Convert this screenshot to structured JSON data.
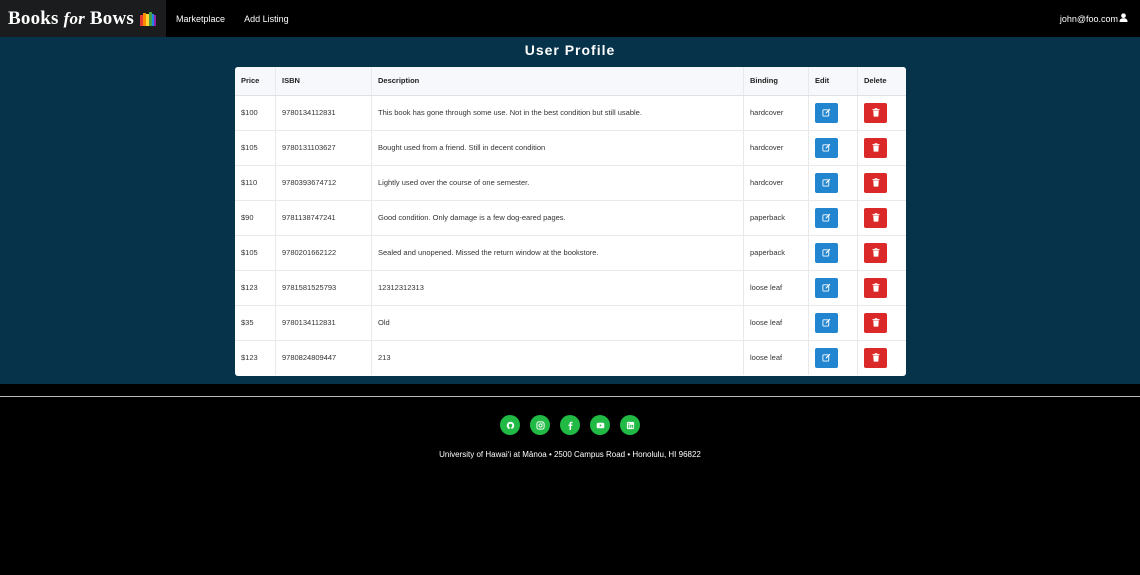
{
  "navbar": {
    "brand": {
      "part1": "Books ",
      "part2": "for",
      "part3": " Bows"
    },
    "items": [
      {
        "label": "Marketplace"
      },
      {
        "label": "Add Listing"
      }
    ],
    "user": "john@foo.com"
  },
  "page": {
    "title": "User Profile"
  },
  "table": {
    "headers": {
      "price": "Price",
      "isbn": "ISBN",
      "description": "Description",
      "binding": "Binding",
      "edit": "Edit",
      "delete": "Delete"
    },
    "rows": [
      {
        "price": "$100",
        "isbn": "9780134112831",
        "description": "This book has gone through some use. Not in the best condition but still usable.",
        "binding": "hardcover"
      },
      {
        "price": "$105",
        "isbn": "9780131103627",
        "description": "Bought used from a friend. Still in decent condition",
        "binding": "hardcover"
      },
      {
        "price": "$110",
        "isbn": "9780393674712",
        "description": "Lightly used over the course of one semester.",
        "binding": "hardcover"
      },
      {
        "price": "$90",
        "isbn": "9781138747241",
        "description": "Good condition. Only damage is a few dog-eared pages.",
        "binding": "paperback"
      },
      {
        "price": "$105",
        "isbn": "9780201662122",
        "description": "Sealed and unopened. Missed the return window at the bookstore.",
        "binding": "paperback"
      },
      {
        "price": "$123",
        "isbn": "9781581525793",
        "description": "12312312313",
        "binding": "loose leaf"
      },
      {
        "price": "$35",
        "isbn": "9780134112831",
        "description": "Old",
        "binding": "loose leaf"
      },
      {
        "price": "$123",
        "isbn": "9780824809447",
        "description": "213",
        "binding": "loose leaf"
      }
    ]
  },
  "footer": {
    "socials": [
      {
        "icon": "github-icon"
      },
      {
        "icon": "instagram-icon"
      },
      {
        "icon": "facebook-icon"
      },
      {
        "icon": "youtube-icon"
      },
      {
        "icon": "linkedin-icon"
      }
    ],
    "address": "University of Hawai‘i at Mānoa • 2500 Campus Road • Honolulu, HI 96822"
  },
  "colors": {
    "nav_bg": "#000000",
    "main_bg": "#06324a",
    "edit_button": "#2185d0",
    "delete_button": "#db2828",
    "social_green": "#21ba45"
  }
}
